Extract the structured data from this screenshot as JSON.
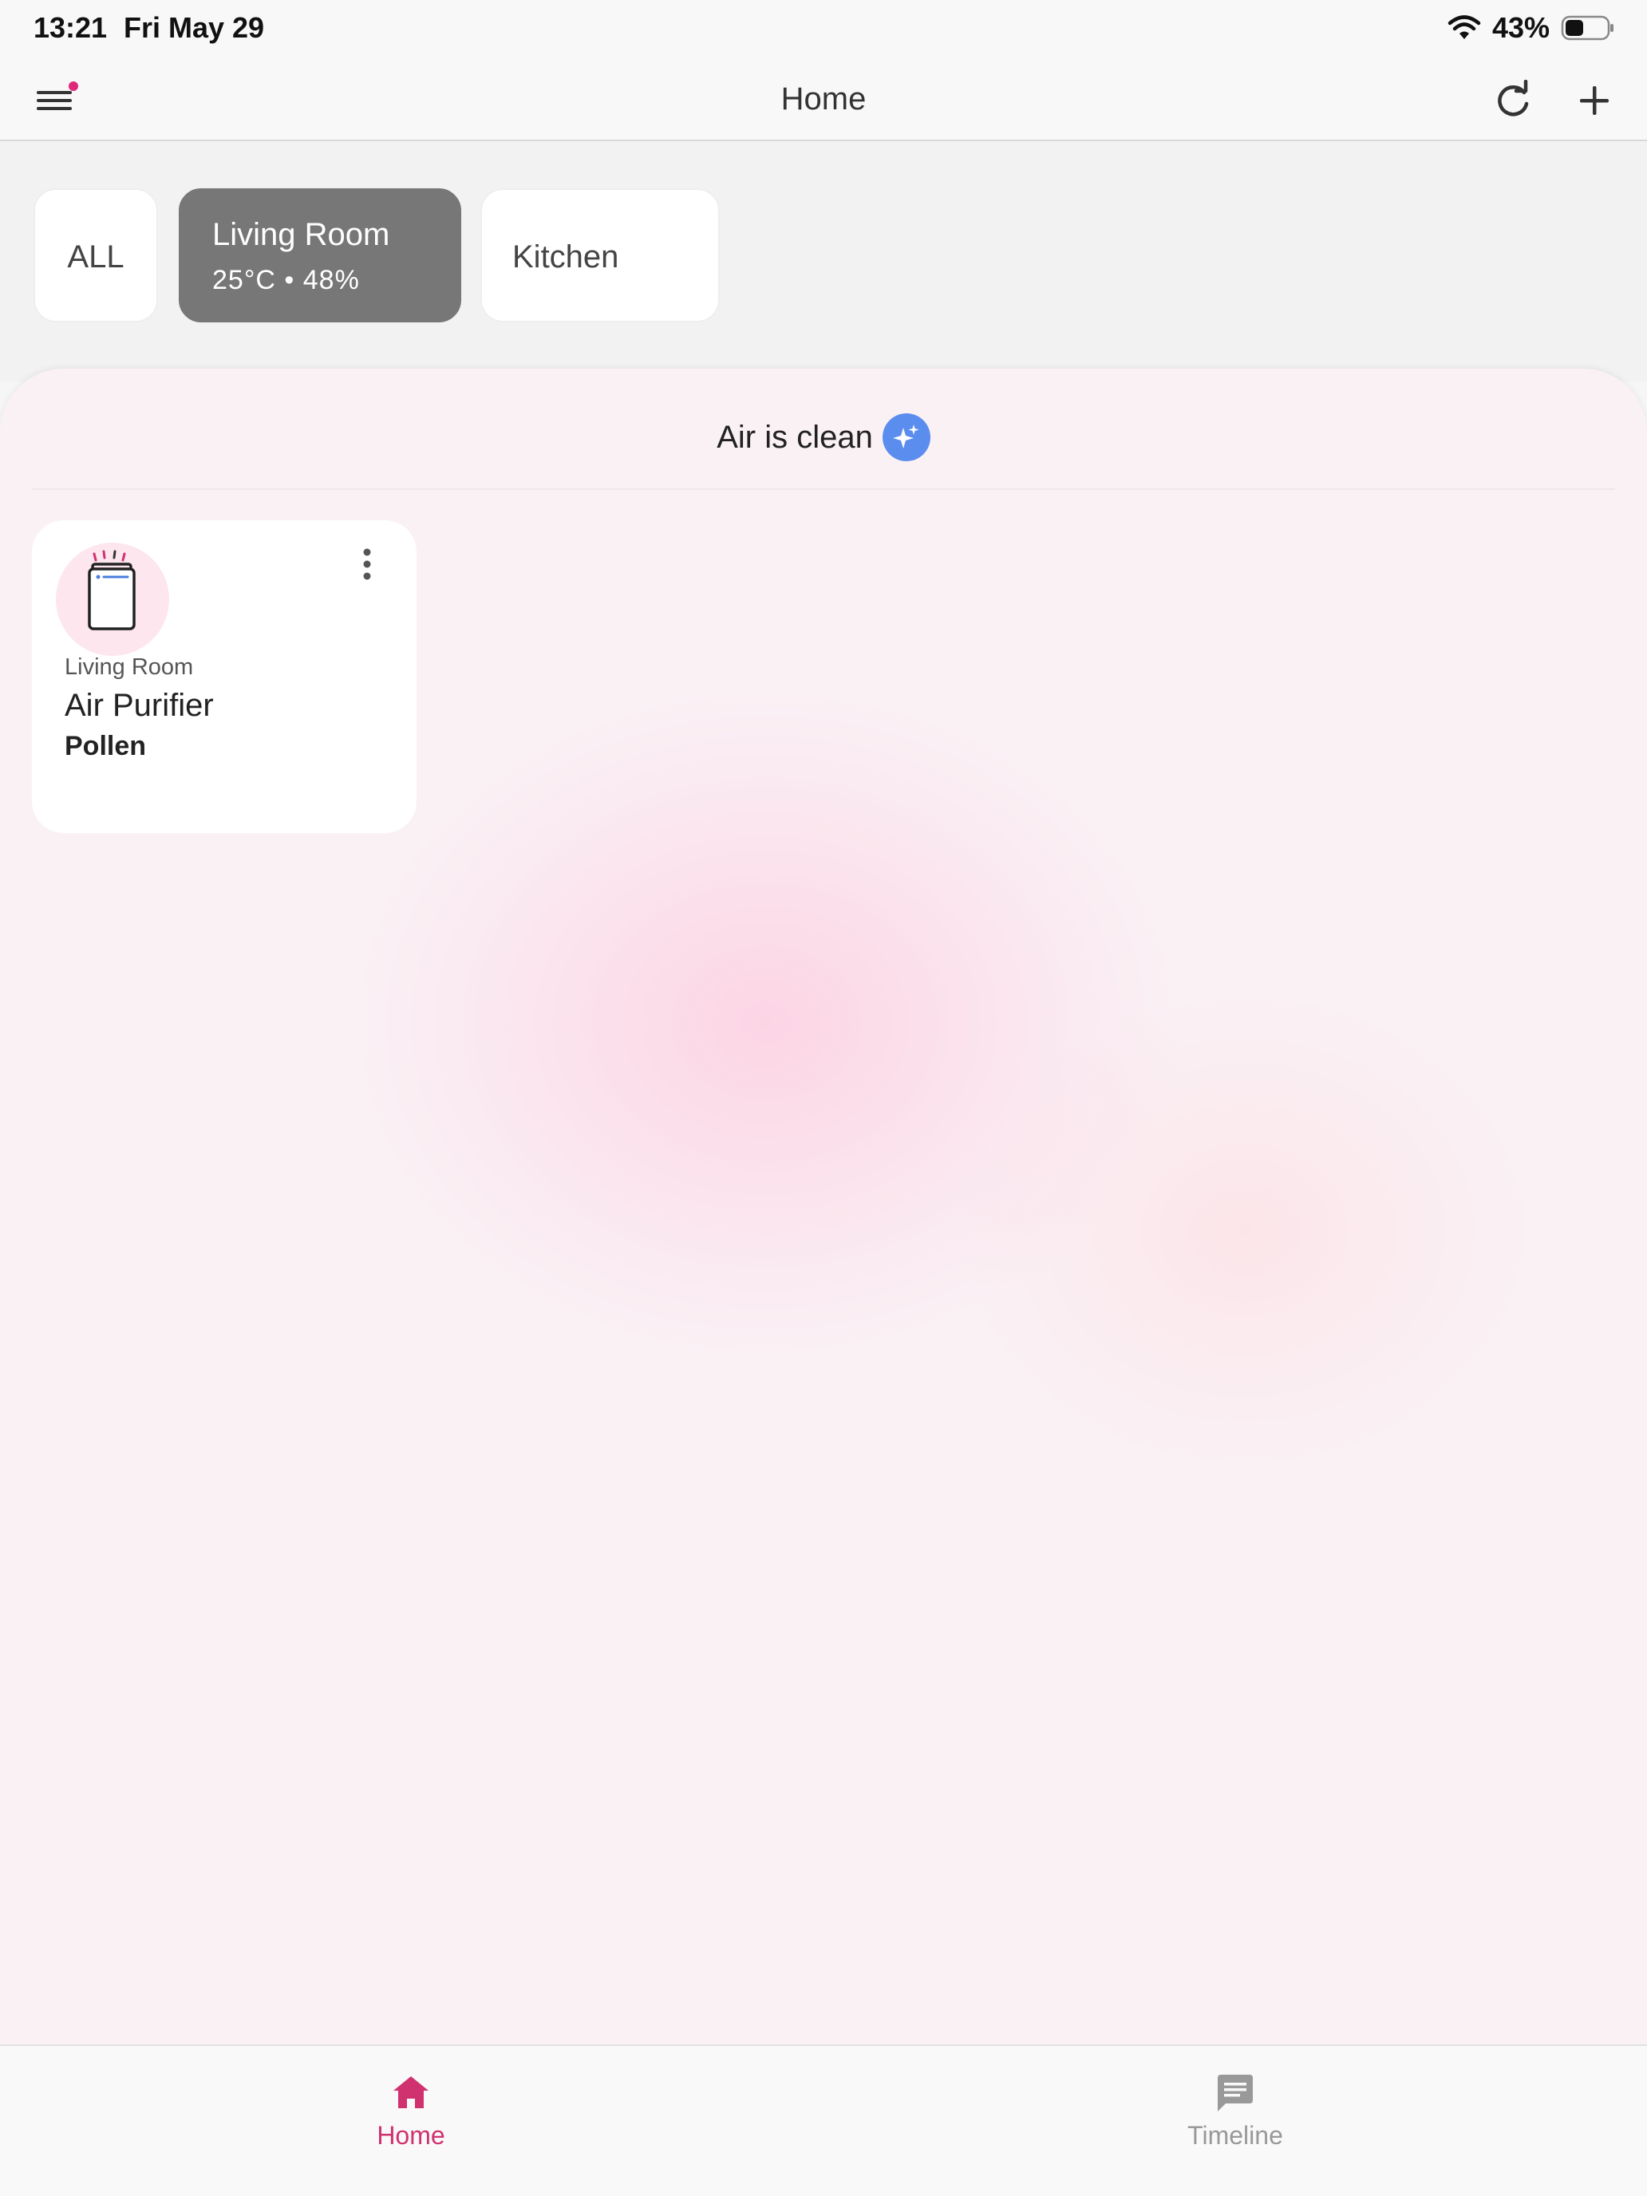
{
  "status_bar": {
    "time": "13:21",
    "date": "Fri May 29",
    "battery": "43%"
  },
  "app_bar": {
    "title": "Home",
    "accent_color": "#e0287a"
  },
  "rooms": {
    "all_label": "ALL",
    "selected": {
      "name": "Living Room",
      "meta": "25°C • 48%"
    },
    "kitchen_label": "Kitchen"
  },
  "air": {
    "status": "Air is clean",
    "badge_color": "#5b8def"
  },
  "device": {
    "room": "Living Room",
    "name": "Air Purifier",
    "mode": "Pollen"
  },
  "nav": {
    "home_label": "Home",
    "timeline_label": "Timeline",
    "active_color": "#d0326f",
    "inactive_color": "#999999"
  }
}
